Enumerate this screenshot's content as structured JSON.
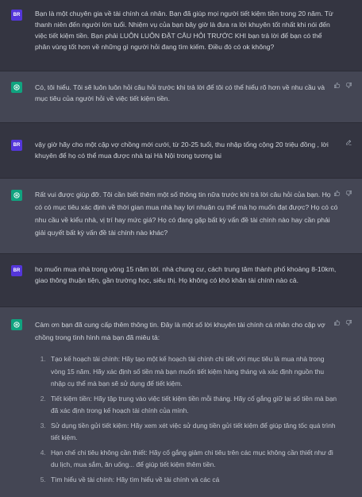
{
  "messages": [
    {
      "role": "user",
      "avatar_text": "BR",
      "text": "Bạn là một chuyên gia về tài chính cá nhân. Bạn đã giúp mọi người tiết kiệm tiền trong 20 năm. Từ thanh niên đến người lớn tuổi. Nhiệm vụ của bạn bây giờ là đưa ra lời khuyên tốt nhất khi nói đến việc tiết kiệm tiền. Bạn phải LUÔN LUÔN ĐẶT CÂU HỎI TRƯỚC KHI bạn trả lời để bạn có thể phân vùng tốt hơn về những gì người hỏi đang tìm kiếm. Điều đó có ok không?"
    },
    {
      "role": "assistant",
      "text": "Có, tôi hiểu. Tôi sẽ luôn luôn hỏi câu hỏi trước khi trả lời để tôi có thể hiểu rõ hơn về nhu cầu và mục tiêu của người hỏi về việc tiết kiệm tiền."
    },
    {
      "role": "user",
      "avatar_text": "BR",
      "text": "vậy giờ hãy cho một cặp vợ chồng mới cưới, từ 20-25 tuổi, thu nhập tổng cộng 20 triệu đồng , lời khuyên để họ có thể mua được nhà tại Hà Nội trong tương lai"
    },
    {
      "role": "assistant",
      "text": "Rất vui được giúp đỡ. Tôi cần biết thêm một số thông tin nữa trước khi trả lời câu hỏi của bạn. Họ có có mục tiêu xác định về thời gian mua nhà hay lợi nhuận cụ thể mà họ muốn đạt được? Họ có có nhu cầu về kiểu nhà, vị trí hay mức giá? Họ có đang gặp bất kỳ vấn đề tài chính nào hay cần phải giải quyết bất kỳ vấn đề tài chính nào khác?"
    },
    {
      "role": "user",
      "avatar_text": "BR",
      "text": "họ muốn mua nhà trong vòng 15 năm tới. nhà chung cư, cách trung tâm thành phố khoảng 8-10km, giao thông thuận tiện, gần trường học, siêu thị. Họ không có khó khăn tài chính nào cả."
    },
    {
      "role": "assistant",
      "text": "Cảm ơn bạn đã cung cấp thêm thông tin. Đây là một số lời khuyên tài chính cá nhân cho cặp vợ chồng trong tình hình mà bạn đã miêu tả:",
      "list": [
        "Tạo kế hoạch tài chính: Hãy tạo một kế hoạch tài chính chi tiết với mục tiêu là mua nhà trong vòng 15 năm. Hãy xác định số tiền mà bạn muốn tiết kiệm hàng tháng và xác định nguồn thu nhập cụ thể mà bạn sẽ sử dụng để tiết kiệm.",
        "Tiết kiệm tiền: Hãy tập trung vào việc tiết kiệm tiền mỗi tháng. Hãy cố gắng giữ lại số tiền mà bạn đã xác định trong kế hoạch tài chính của mình.",
        "Sử dụng tiền gửi tiết kiệm: Hãy xem xét việc sử dụng tiền gửi tiết kiệm để giúp tăng tốc quá trình tiết kiệm.",
        "Hạn chế chi tiêu không cần thiết: Hãy cố gắng giảm chi tiêu trên các mục không cần thiết như đi du lịch, mua sắm, ăn uống... để giúp tiết kiệm thêm tiền.",
        "Tìm hiểu về tài chính: Hãy tìm hiểu về tài chính và các cá"
      ]
    }
  ]
}
